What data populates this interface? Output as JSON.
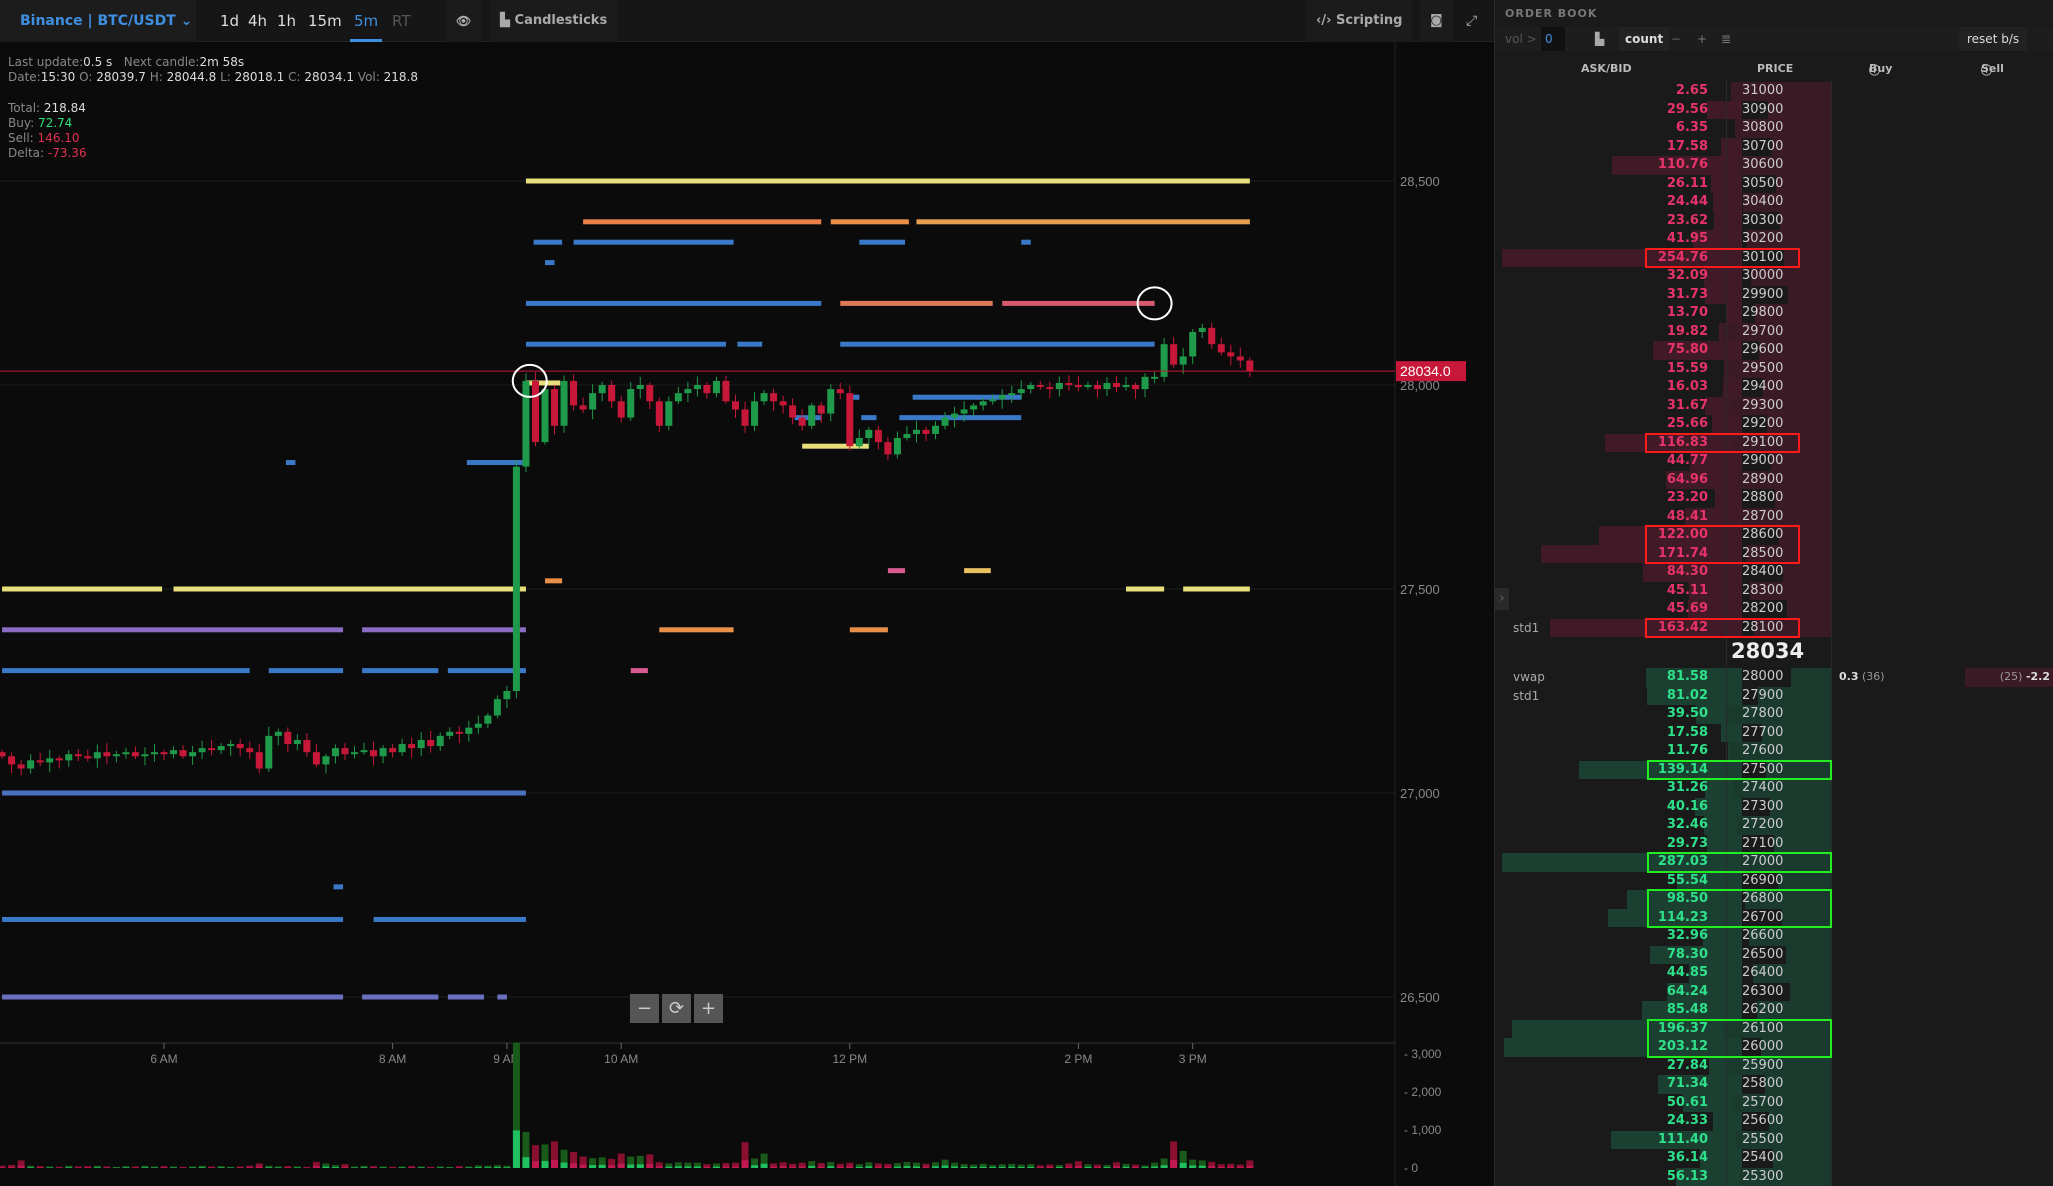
{
  "header": {
    "market": "Binance | BTC/USDT",
    "timeframes": [
      "1d",
      "4h",
      "1h",
      "15m",
      "5m",
      "RT"
    ],
    "active_timeframe": "5m",
    "chart_type": "Candlesticks",
    "scripting": "Scripting"
  },
  "info": {
    "last_update_label": "Last update:",
    "last_update": "0.5 s",
    "next_candle_label": "Next candle:",
    "next_candle": "2m 58s",
    "date_label": "Date:",
    "date": "15:30",
    "o_label": "O:",
    "o": "28039.7",
    "h_label": "H:",
    "h": "28044.8",
    "l_label": "L:",
    "l": "28018.1",
    "c_label": "C:",
    "c": "28034.1",
    "vol_label": "Vol:",
    "vol": "218.8",
    "total_label": "Total:",
    "total": "218.84",
    "buy_label": "Buy:",
    "buy": "72.74",
    "sell_label": "Sell:",
    "sell": "146.10",
    "delta_label": "Delta:",
    "delta": "-73.36"
  },
  "colors": {
    "up": "#1f9a4a",
    "down": "#c8183a",
    "ask": "#e8336a",
    "bid": "#2ee08a",
    "accent": "#3f8fe0",
    "current": "#c8183a"
  },
  "chart_data": {
    "type": "candlestick",
    "start_time": "04:35",
    "interval_minutes": 5,
    "closes": [
      27090,
      27070,
      27060,
      27080,
      27075,
      27085,
      27080,
      27095,
      27090,
      27085,
      27100,
      27090,
      27095,
      27100,
      27090,
      27095,
      27100,
      27095,
      27105,
      27090,
      27100,
      27110,
      27105,
      27115,
      27120,
      27110,
      27100,
      27060,
      27140,
      27150,
      27120,
      27130,
      27100,
      27070,
      27090,
      27110,
      27095,
      27100,
      27105,
      27090,
      27110,
      27100,
      27120,
      27110,
      27130,
      27115,
      27140,
      27150,
      27145,
      27160,
      27170,
      27190,
      27230,
      27250,
      27800,
      28010,
      27860,
      27990,
      27900,
      28010,
      27950,
      27940,
      27980,
      28000,
      27960,
      27920,
      27990,
      28000,
      27960,
      27900,
      27960,
      27980,
      27990,
      28000,
      27980,
      28010,
      27960,
      27940,
      27900,
      27960,
      27980,
      27960,
      27950,
      27920,
      27900,
      27950,
      27930,
      27990,
      27980,
      27850,
      27870,
      27890,
      27860,
      27830,
      27870,
      27880,
      27890,
      27880,
      27900,
      27920,
      27930,
      27940,
      27950,
      27960,
      27965,
      27975,
      27980,
      27990,
      28000,
      27995,
      27990,
      28005,
      28000,
      27995,
      28000,
      27990,
      28005,
      27995,
      28000,
      27990,
      28020,
      28020,
      28100,
      28050,
      28070,
      28130,
      28140,
      28100,
      28080,
      28070,
      28060,
      28034
    ],
    "volumes": [
      60,
      80,
      200,
      60,
      50,
      40,
      30,
      60,
      40,
      50,
      60,
      40,
      30,
      50,
      40,
      60,
      40,
      50,
      40,
      30,
      40,
      60,
      40,
      50,
      30,
      40,
      60,
      120,
      60,
      40,
      50,
      40,
      30,
      160,
      120,
      80,
      100,
      40,
      60,
      50,
      40,
      30,
      40,
      50,
      40,
      30,
      40,
      30,
      50,
      40,
      70,
      60,
      80,
      60,
      3300,
      950,
      600,
      620,
      700,
      480,
      420,
      300,
      260,
      280,
      240,
      380,
      300,
      320,
      360,
      150,
      120,
      150,
      140,
      140,
      100,
      120,
      130,
      140,
      680,
      250,
      380,
      120,
      150,
      110,
      140,
      180,
      130,
      160,
      110,
      140,
      100,
      150,
      120,
      110,
      130,
      160,
      140,
      110,
      150,
      220,
      140,
      100,
      90,
      110,
      80,
      100,
      110,
      90,
      100,
      70,
      90,
      80,
      120,
      180,
      100,
      90,
      80,
      150,
      110,
      90,
      70,
      140,
      250,
      700,
      450,
      220,
      200,
      160,
      100,
      110,
      90,
      200
    ],
    "price_ticks": [
      "28,500",
      "28,000",
      "27,500",
      "27,000",
      "26,500"
    ],
    "price_tick_values": [
      28500,
      28000,
      27500,
      27000,
      26500
    ],
    "time_ticks": [
      "6 AM",
      "8 AM",
      "9 AM",
      "10 AM",
      "12 PM",
      "2 PM",
      "3 PM"
    ],
    "time_tick_values": [
      "06:00",
      "08:00",
      "09:00",
      "10:00",
      "12:00",
      "14:00",
      "15:00"
    ],
    "volume_ticks": [
      "3,000",
      "2,000",
      "1,000",
      "0"
    ],
    "volume_tick_values": [
      3000,
      2000,
      1000,
      0
    ],
    "current_price": 28034,
    "current_price_label": "28034.0",
    "order_levels": [
      {
        "price": 28500,
        "from": "09:10",
        "to": "15:30",
        "color": "#e8df7a"
      },
      {
        "price": 28400,
        "from": "09:40",
        "to": "11:45",
        "color": "#e8804a"
      },
      {
        "price": 28400,
        "from": "11:50",
        "to": "12:31",
        "color": "#e8904a"
      },
      {
        "price": 28400,
        "from": "12:35",
        "to": "15:30",
        "color": "#e8a050"
      },
      {
        "price": 28350,
        "from": "09:14",
        "to": "09:29",
        "color": "#3a78c8"
      },
      {
        "price": 28350,
        "from": "09:35",
        "to": "10:59",
        "color": "#3a78c8"
      },
      {
        "price": 28350,
        "from": "12:05",
        "to": "12:29",
        "color": "#3a78c8"
      },
      {
        "price": 28350,
        "from": "13:30",
        "to": "13:35",
        "color": "#3a78c8"
      },
      {
        "price": 28300,
        "from": "09:20",
        "to": "09:25",
        "color": "#3a78c8"
      },
      {
        "price": 28200,
        "from": "09:10",
        "to": "11:45",
        "color": "#3a78c8"
      },
      {
        "price": 28200,
        "from": "11:55",
        "to": "13:15",
        "color": "#e0785a"
      },
      {
        "price": 28200,
        "from": "13:20",
        "to": "14:40",
        "color": "#d85a70"
      },
      {
        "price": 28100,
        "from": "09:10",
        "to": "10:55",
        "color": "#3a78c8"
      },
      {
        "price": 28100,
        "from": "11:01",
        "to": "11:14",
        "color": "#3a78c8"
      },
      {
        "price": 28100,
        "from": "11:55",
        "to": "14:40",
        "color": "#3a78c8"
      },
      {
        "price": 28005,
        "from": "09:10",
        "to": "09:28",
        "color": "#e8df7a"
      },
      {
        "price": 27970,
        "from": "12:01",
        "to": "12:05",
        "color": "#3a78c8"
      },
      {
        "price": 27970,
        "from": "12:33",
        "to": "13:30",
        "color": "#3a78c8"
      },
      {
        "price": 27920,
        "from": "11:31",
        "to": "11:45",
        "color": "#3a78c8"
      },
      {
        "price": 27920,
        "from": "12:06",
        "to": "12:14",
        "color": "#3a78c8"
      },
      {
        "price": 27920,
        "from": "12:26",
        "to": "13:30",
        "color": "#3a78c8"
      },
      {
        "price": 27850,
        "from": "11:35",
        "to": "12:10",
        "color": "#e8df7a"
      },
      {
        "price": 27810,
        "from": "07:04",
        "to": "07:09",
        "color": "#3a78c8"
      },
      {
        "price": 27810,
        "from": "08:39",
        "to": "09:10",
        "color": "#3a78c8"
      },
      {
        "price": 27545,
        "from": "12:20",
        "to": "12:29",
        "color": "#d85a90"
      },
      {
        "price": 27545,
        "from": "13:00",
        "to": "13:14",
        "color": "#e8c060"
      },
      {
        "price": 27520,
        "from": "09:20",
        "to": "09:29",
        "color": "#e8904a"
      },
      {
        "price": 27500,
        "from": "04:35",
        "to": "05:59",
        "color": "#e8df7a"
      },
      {
        "price": 27500,
        "from": "06:05",
        "to": "09:10",
        "color": "#e8df7a"
      },
      {
        "price": 27500,
        "from": "14:25",
        "to": "14:45",
        "color": "#e8df7a"
      },
      {
        "price": 27500,
        "from": "14:55",
        "to": "15:30",
        "color": "#e8df7a"
      },
      {
        "price": 27400,
        "from": "04:35",
        "to": "07:34",
        "color": "#8a6cc0"
      },
      {
        "price": 27400,
        "from": "07:44",
        "to": "09:10",
        "color": "#8a6cc0"
      },
      {
        "price": 27400,
        "from": "10:20",
        "to": "10:59",
        "color": "#e8904a"
      },
      {
        "price": 27400,
        "from": "12:00",
        "to": "12:20",
        "color": "#e8904a"
      },
      {
        "price": 27300,
        "from": "04:35",
        "to": "06:45",
        "color": "#3a78c8"
      },
      {
        "price": 27300,
        "from": "06:55",
        "to": "07:34",
        "color": "#3a78c8"
      },
      {
        "price": 27300,
        "from": "07:44",
        "to": "08:24",
        "color": "#3a78c8"
      },
      {
        "price": 27300,
        "from": "08:29",
        "to": "09:10",
        "color": "#3a78c8"
      },
      {
        "price": 27300,
        "from": "10:05",
        "to": "10:14",
        "color": "#d85a90"
      },
      {
        "price": 27000,
        "from": "04:35",
        "to": "09:10",
        "color": "#4a70c0"
      },
      {
        "price": 26770,
        "from": "07:29",
        "to": "07:34",
        "color": "#3a78c8"
      },
      {
        "price": 26690,
        "from": "04:35",
        "to": "07:34",
        "color": "#3a78c8"
      },
      {
        "price": 26690,
        "from": "07:50",
        "to": "09:10",
        "color": "#3a78c8"
      },
      {
        "price": 26500,
        "from": "04:35",
        "to": "07:34",
        "color": "#6a70c0"
      },
      {
        "price": 26500,
        "from": "07:44",
        "to": "08:24",
        "color": "#6a70c0"
      },
      {
        "price": 26500,
        "from": "08:29",
        "to": "08:48",
        "color": "#6a70c0"
      },
      {
        "price": 26500,
        "from": "08:55",
        "to": "09:00",
        "color": "#6a70c0"
      }
    ],
    "annotations": [
      {
        "shape": "circle",
        "time": "09:12",
        "price": 28010,
        "color": "#ffffff"
      },
      {
        "shape": "circle",
        "time": "14:40",
        "price": 28200,
        "color": "#ffffff"
      }
    ]
  },
  "zoom_controls": [
    "−",
    "⟳",
    "+"
  ],
  "orderbook": {
    "title": "ORDER BOOK",
    "vol_label": "vol >",
    "vol_value": "0",
    "count_label": "count",
    "minus": "−",
    "plus": "+",
    "reset_label": "reset b/s",
    "columns": [
      "ASK/BID",
      "PRICE",
      "Buy",
      "Sell"
    ],
    "asks": [
      [
        31000,
        "2.65"
      ],
      [
        30900,
        "29.56"
      ],
      [
        30800,
        "6.35"
      ],
      [
        30700,
        "17.58"
      ],
      [
        30600,
        "110.76"
      ],
      [
        30500,
        "26.11"
      ],
      [
        30400,
        "24.44"
      ],
      [
        30300,
        "23.62"
      ],
      [
        30200,
        "41.95"
      ],
      [
        30100,
        "254.76"
      ],
      [
        30000,
        "32.09"
      ],
      [
        29900,
        "31.73"
      ],
      [
        29800,
        "13.70"
      ],
      [
        29700,
        "19.82"
      ],
      [
        29600,
        "75.80"
      ],
      [
        29500,
        "15.59"
      ],
      [
        29400,
        "16.03"
      ],
      [
        29300,
        "31.67"
      ],
      [
        29200,
        "25.66"
      ],
      [
        29100,
        "116.83"
      ],
      [
        29000,
        "44.77"
      ],
      [
        28900,
        "64.96"
      ],
      [
        28800,
        "23.20"
      ],
      [
        28700,
        "48.41"
      ],
      [
        28600,
        "122.00"
      ],
      [
        28500,
        "171.74"
      ],
      [
        28400,
        "84.30"
      ],
      [
        28300,
        "45.11"
      ],
      [
        28200,
        "45.69"
      ],
      [
        28100,
        "163.42"
      ]
    ],
    "mid_price": "28034",
    "bids": [
      [
        28000,
        "81.58"
      ],
      [
        27900,
        "81.02"
      ],
      [
        27800,
        "39.50"
      ],
      [
        27700,
        "17.58"
      ],
      [
        27600,
        "11.76"
      ],
      [
        27500,
        "139.14"
      ],
      [
        27400,
        "31.26"
      ],
      [
        27300,
        "40.16"
      ],
      [
        27200,
        "32.46"
      ],
      [
        27100,
        "29.73"
      ],
      [
        27000,
        "287.03"
      ],
      [
        26900,
        "55.54"
      ],
      [
        26800,
        "98.50"
      ],
      [
        26700,
        "114.23"
      ],
      [
        26600,
        "32.96"
      ],
      [
        26500,
        "78.30"
      ],
      [
        26400,
        "44.85"
      ],
      [
        26300,
        "64.24"
      ],
      [
        26200,
        "85.48"
      ],
      [
        26100,
        "196.37"
      ],
      [
        26000,
        "203.12"
      ],
      [
        25900,
        "27.84"
      ],
      [
        25800,
        "71.34"
      ],
      [
        25700,
        "50.61"
      ],
      [
        25600,
        "24.33"
      ],
      [
        25500,
        "111.40"
      ],
      [
        25400,
        "36.14"
      ],
      [
        25300,
        "56.13"
      ]
    ],
    "ask_labels": [
      {
        "price": 28100,
        "text": "std1"
      }
    ],
    "bid_labels": [
      {
        "price": 28000,
        "text": "vwap"
      },
      {
        "price": 27900,
        "text": "std1"
      }
    ],
    "vwap_buy": "0.3",
    "vwap_buy_count": "(36)",
    "vwap_sell_count": "(25)",
    "vwap_sell": "-2.2",
    "highlight_asks": [
      [
        30100
      ],
      [
        29100
      ],
      [
        28600,
        28500
      ],
      [
        28100
      ]
    ],
    "highlight_bids": [
      [
        27500
      ],
      [
        27000
      ],
      [
        26800,
        26700
      ],
      [
        26100,
        26000
      ]
    ]
  }
}
